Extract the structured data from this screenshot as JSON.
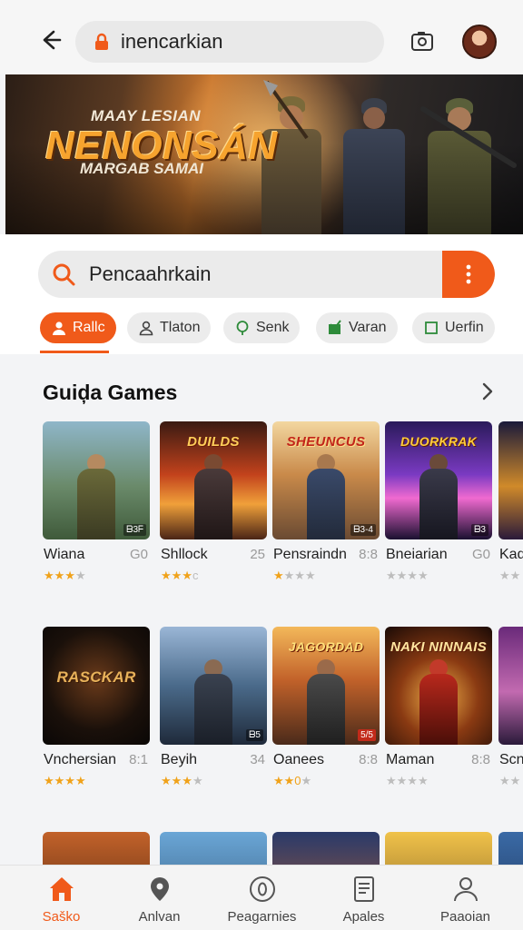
{
  "topbar": {
    "url_text": "inencarkian"
  },
  "banner": {
    "line1": "MAAY LESIAN",
    "headline": "NENONSÁN",
    "line3": "MARGAB SAMAI"
  },
  "search": {
    "text": "Pencaahrkain"
  },
  "chips": [
    {
      "label": "Rallc",
      "icon": "person-icon",
      "active": true
    },
    {
      "label": "Tlaton",
      "icon": "person-outline-icon",
      "active": false
    },
    {
      "label": "Senk",
      "icon": "pin-icon",
      "active": false
    },
    {
      "label": "Varan",
      "icon": "check-box-icon",
      "active": false
    },
    {
      "label": "Uerfin",
      "icon": "square-icon",
      "active": false
    }
  ],
  "section": {
    "title": "Guiḑa Games"
  },
  "games_row1": [
    {
      "name": "Wiana",
      "size": "G0",
      "rating": 3,
      "art_title": "",
      "badge": "ᗷ3ᖴ"
    },
    {
      "name": "Shllock",
      "size": "25",
      "rating": 3,
      "art_title": "DUILDS",
      "badge": ""
    },
    {
      "name": "Pensraindn",
      "size": "8:8",
      "rating": 1,
      "art_title": "SHEUNCUS",
      "badge": "ᗷ3-4"
    },
    {
      "name": "Bneiarian",
      "size": "G0",
      "rating": 0,
      "art_title": "DUORKRAK",
      "badge": "ᗷ3"
    },
    {
      "name": "Kad",
      "size": "",
      "rating": 0,
      "art_title": "",
      "badge": ""
    }
  ],
  "games_row2": [
    {
      "name": "Vnchersian",
      "size": "8:1",
      "rating": 4,
      "art_title": "RASCKAR",
      "badge": ""
    },
    {
      "name": "Beyih",
      "size": "34",
      "rating": 3,
      "art_title": "",
      "badge": "ᗷ5"
    },
    {
      "name": "Oanees",
      "size": "8:8",
      "rating": 2,
      "art_title": "JAGORDAD",
      "badge": "5/5"
    },
    {
      "name": "Maman",
      "size": "8:8",
      "rating": 0,
      "art_title": "NAKI NINNAIS",
      "badge": ""
    },
    {
      "name": "Scn",
      "size": "",
      "rating": 0,
      "art_title": "",
      "badge": ""
    }
  ],
  "bottom_nav": [
    {
      "label": "Saško",
      "icon": "home-icon",
      "active": true
    },
    {
      "label": "Anlvan",
      "icon": "location-pin-icon",
      "active": false
    },
    {
      "label": "Peagarnies",
      "icon": "circle-zero-icon",
      "active": false
    },
    {
      "label": "Apales",
      "icon": "document-icon",
      "active": false
    },
    {
      "label": "Paaoian",
      "icon": "person-outline-icon",
      "active": false
    }
  ],
  "colors": {
    "accent": "#f05a1a",
    "star": "#f0a21a",
    "star_off": "#bdbdbd"
  }
}
